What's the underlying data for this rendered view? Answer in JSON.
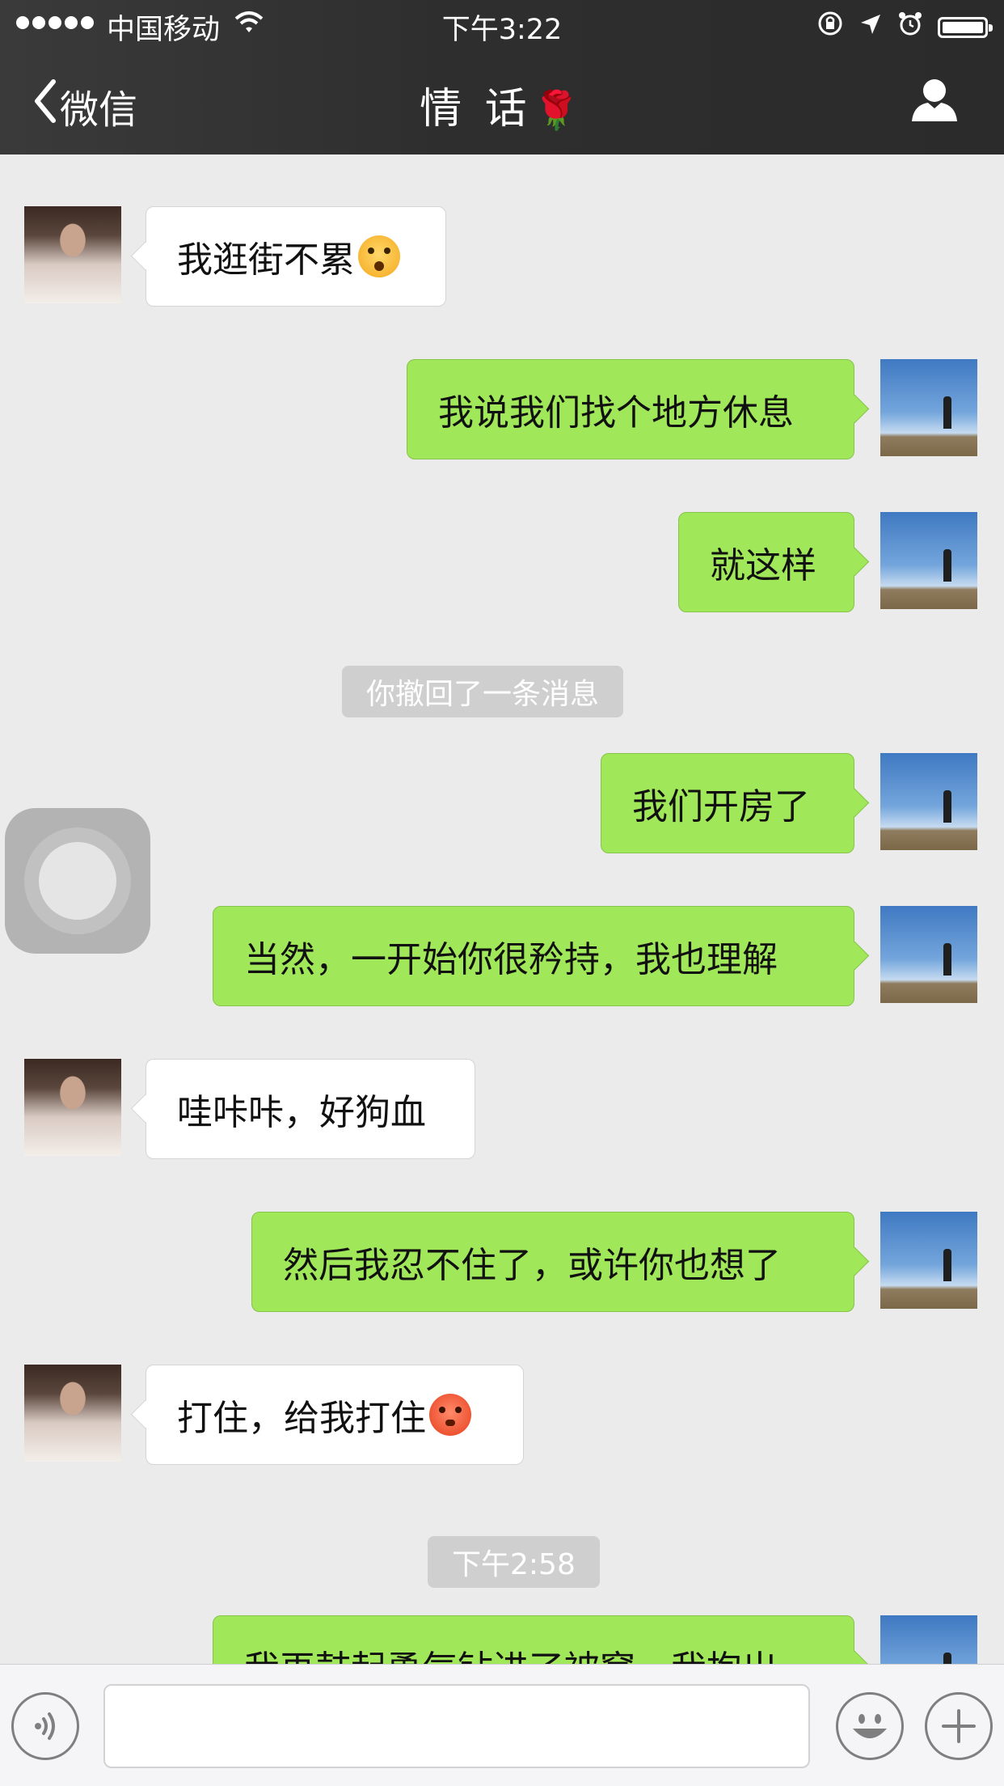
{
  "status_bar": {
    "carrier": "中国移动",
    "time": "下午3:22",
    "signal_dots": 5,
    "battery_level": 0.95
  },
  "nav": {
    "back_label": "微信",
    "title": "情 话",
    "title_emoji": "🌹",
    "icons": [
      "chevron-left-icon",
      "rose-icon",
      "person-icon"
    ]
  },
  "messages": [
    {
      "side": "left",
      "text": "我逛街不累",
      "emoji": "astonished"
    },
    {
      "side": "right",
      "text": "我说我们找个地方休息"
    },
    {
      "side": "right",
      "text": "就这样"
    },
    {
      "type": "system",
      "text": "你撤回了一条消息"
    },
    {
      "side": "right",
      "text": "我们开房了"
    },
    {
      "side": "right",
      "text": "当然，一开始你很矜持，我也理解"
    },
    {
      "side": "left",
      "text": "哇咔咔，好狗血"
    },
    {
      "side": "right",
      "text": "然后我忍不住了，或许你也想了"
    },
    {
      "side": "left",
      "text": "打住，给我打住",
      "emoji": "flushed"
    },
    {
      "type": "time",
      "text": "下午2:58"
    },
    {
      "side": "right",
      "text": "我再鼓起勇气钻进了被窝，我抱出"
    }
  ],
  "input_bar": {
    "placeholder": "",
    "value": "",
    "icons": [
      "voice-icon",
      "emoji-icon",
      "plus-icon"
    ]
  },
  "colors": {
    "nav_bg": "#2e2e2e",
    "chat_bg": "#ebebeb",
    "bubble_right": "#a0e75a",
    "bubble_left": "#ffffff",
    "system_bubble": "#cfcfcf"
  }
}
